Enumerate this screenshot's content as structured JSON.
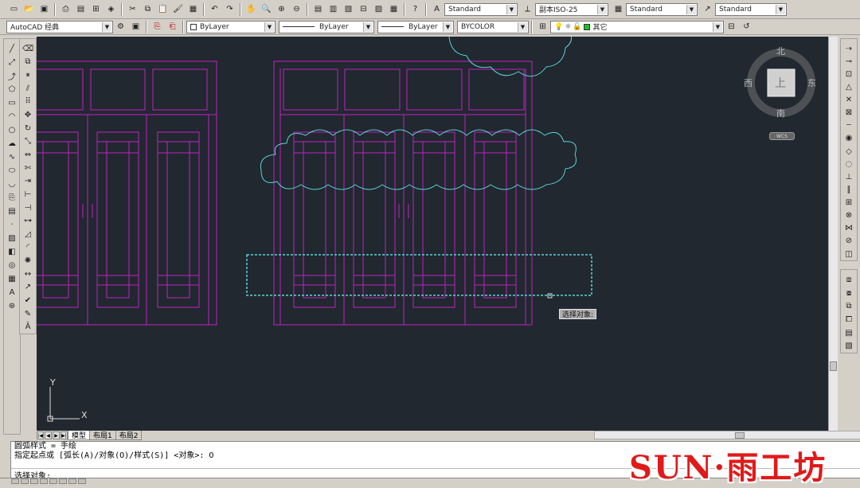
{
  "toolbar1": {
    "text_style": "Standard",
    "dim_style": "副本ISO-25",
    "table_style": "Standard",
    "multileader_style": "Standard"
  },
  "toolbar2": {
    "workspace": "AutoCAD 经典",
    "layer_color": "ByLayer",
    "linetype": "ByLayer",
    "lineweight": "ByLayer",
    "plotstyle": "BYCOLOR",
    "current_layer": "其它"
  },
  "viewcube": {
    "north": "北",
    "south": "南",
    "east": "东",
    "west": "西",
    "face": "上",
    "wcs": "WCS"
  },
  "tooltip": "选择对象:",
  "ucs": {
    "x": "X",
    "y": "Y"
  },
  "tabs": [
    {
      "label": "模型"
    },
    {
      "label": "布局1"
    },
    {
      "label": "布局2"
    }
  ],
  "command": {
    "history1": "圆弧样式 = 手绘",
    "history2": "指定起点或 [弧长(A)/对象(O)/样式(S)] <对象>: O",
    "prompt": "选择对象:"
  },
  "watermark": "SUN·雨工坊",
  "colors": {
    "canvas": "#212830",
    "cabinet": "#c31fc3",
    "revcloud": "#5ad2d6",
    "selection": "#5ad2d6"
  }
}
